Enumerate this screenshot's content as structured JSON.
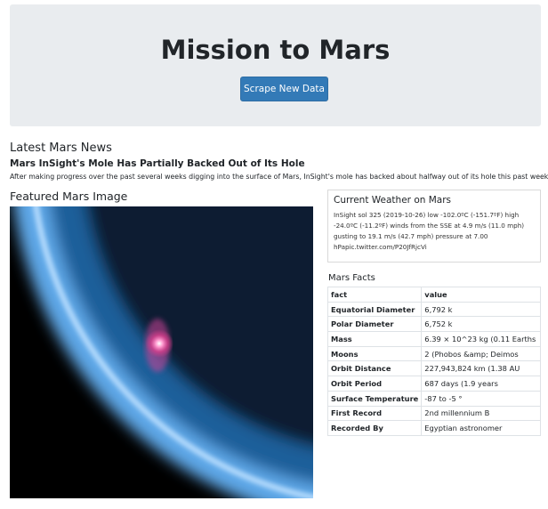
{
  "header": {
    "title": "Mission to Mars",
    "scrape_button": "Scrape New Data"
  },
  "news": {
    "heading": "Latest Mars News",
    "title": "Mars InSight's Mole Has Partially Backed Out of Its Hole",
    "paragraph": "After making progress over the past several weeks digging into the surface of Mars, InSight's mole has backed about halfway out of its hole this past weekend."
  },
  "featured_image": {
    "heading": "Featured Mars Image"
  },
  "weather": {
    "heading": "Current Weather on Mars",
    "text": "InSight sol 325 (2019-10-26) low -102.0ºC (-151.7ºF) high -24.0ºC (-11.2ºF) winds from the SSE at 4.9 m/s (11.0 mph) gusting to 19.1 m/s (42.7 mph) pressure at 7.00 hPapic.twitter.com/P20JfRjcVi"
  },
  "facts": {
    "heading": "Mars Facts",
    "columns": [
      "fact",
      "value"
    ],
    "rows": [
      [
        "Equatorial Diameter",
        "6,792 k"
      ],
      [
        "Polar Diameter",
        "6,752 k"
      ],
      [
        "Mass",
        "6.39 × 10^23 kg (0.11 Earths"
      ],
      [
        "Moons",
        "2 (Phobos &amp; Deimos"
      ],
      [
        "Orbit Distance",
        "227,943,824 km (1.38 AU"
      ],
      [
        "Orbit Period",
        "687 days (1.9 years"
      ],
      [
        "Surface Temperature",
        "-87 to -5 °"
      ],
      [
        "First Record",
        "2nd millennium B"
      ],
      [
        "Recorded By",
        "Egyptian astronomer"
      ]
    ]
  }
}
